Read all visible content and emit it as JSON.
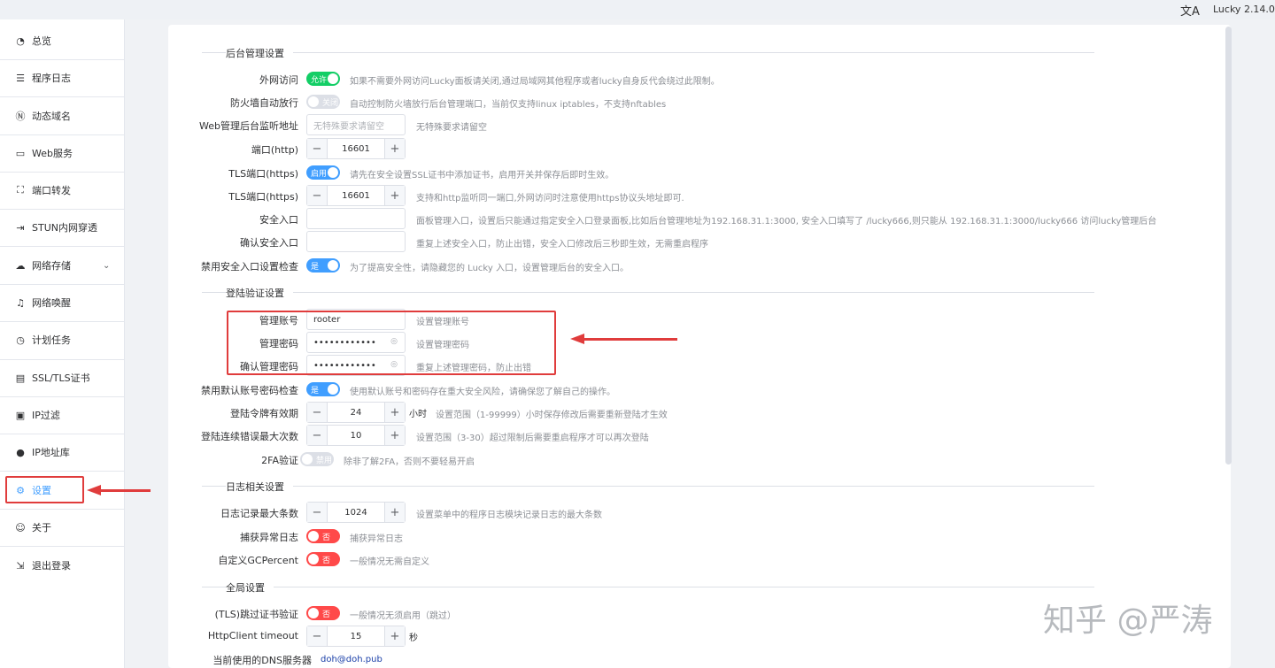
{
  "topbar": {
    "lang_icon": "文A",
    "version": "Lucky 2.14.0"
  },
  "nav": [
    {
      "label": "总览",
      "icon": "dashboard-icon",
      "glyph": "◔"
    },
    {
      "label": "程序日志",
      "icon": "log-icon",
      "glyph": "☰"
    },
    {
      "label": "动态域名",
      "icon": "ddns-icon",
      "glyph": "Ⓝ"
    },
    {
      "label": "Web服务",
      "icon": "web-icon",
      "glyph": "▭"
    },
    {
      "label": "端口转发",
      "icon": "port-forward-icon",
      "glyph": "⛶"
    },
    {
      "label": "STUN内网穿透",
      "icon": "stun-icon",
      "glyph": "⇥"
    },
    {
      "label": "网络存储",
      "icon": "cloud-icon",
      "glyph": "☁"
    },
    {
      "label": "网络唤醒",
      "icon": "bell-icon",
      "glyph": "♫"
    },
    {
      "label": "计划任务",
      "icon": "clock-icon",
      "glyph": "◷"
    },
    {
      "label": "SSL/TLS证书",
      "icon": "certificate-icon",
      "glyph": "▤"
    },
    {
      "label": "IP过滤",
      "icon": "filter-icon",
      "glyph": "▣"
    },
    {
      "label": "IP地址库",
      "icon": "user-icon",
      "glyph": "●"
    },
    {
      "label": "设置",
      "icon": "gear-icon",
      "glyph": "⚙"
    },
    {
      "label": "关于",
      "icon": "about-icon",
      "glyph": "☺"
    },
    {
      "label": "退出登录",
      "icon": "logout-icon",
      "glyph": "⇲"
    }
  ],
  "sections": {
    "admin": "后台管理设置",
    "login": "登陆验证设置",
    "log": "日志相关设置",
    "global": "全局设置"
  },
  "admin": {
    "wan_access": {
      "label": "外网访问",
      "switch": "允许",
      "hint": "如果不需要外网访问Lucky面板请关闭,通过局域网其他程序或者lucky自身反代会绕过此限制。"
    },
    "firewall": {
      "label": "防火墙自动放行",
      "switch": "关闭",
      "hint": "自动控制防火墙放行后台管理端口，当前仅支持linux iptables，不支持nftables"
    },
    "listen_addr": {
      "label": "Web管理后台监听地址",
      "placeholder": "无特殊要求请留空",
      "hint": "无特殊要求请留空"
    },
    "http_port": {
      "label": "端口(http)",
      "value": "16601"
    },
    "tls_switch": {
      "label": "TLS端口(https)",
      "switch": "启用",
      "hint": "请先在安全设置SSL证书中添加证书，启用开关并保存后即时生效。"
    },
    "tls_port": {
      "label": "TLS端口(https)",
      "value": "16601",
      "hint": "支持和http监听同一端口,外网访问时注意使用https协议头地址即可."
    },
    "safe_entry": {
      "label": "安全入口",
      "hint": "面板管理入口，设置后只能通过指定安全入口登录面板,比如后台管理地址为192.168.31.1:3000, 安全入口填写了 /lucky666,则只能从 192.168.31.1:3000/lucky666 访问lucky管理后台"
    },
    "confirm_entry": {
      "label": "确认安全入口",
      "hint": "重复上述安全入口，防止出错，安全入口修改后三秒即生效，无需重启程序"
    },
    "disable_entry_check": {
      "label": "禁用安全入口设置检查",
      "switch": "是",
      "hint": "为了提高安全性，请隐藏您的 Lucky 入口，设置管理后台的安全入口。"
    }
  },
  "login": {
    "account": {
      "label": "管理账号",
      "value": "rooter",
      "hint": "设置管理账号"
    },
    "password": {
      "label": "管理密码",
      "value": "••••••••••••",
      "hint": "设置管理密码"
    },
    "confirm_password": {
      "label": "确认管理密码",
      "value": "••••••••••••",
      "hint": "重复上述管理密码，防止出错"
    },
    "disable_default_check": {
      "label": "禁用默认账号密码检查",
      "switch": "是",
      "hint": "使用默认账号和密码存在重大安全风险，请确保您了解自己的操作。"
    },
    "token_ttl": {
      "label": "登陆令牌有效期",
      "value": "24",
      "unit": "小时",
      "hint": "设置范围（1-99999）小时保存修改后需要重新登陆才生效"
    },
    "max_errors": {
      "label": "登陆连续错误最大次数",
      "value": "10",
      "hint": "设置范围（3-30）超过限制后需要重启程序才可以再次登陆"
    },
    "twofa": {
      "label": "2FA验证",
      "switch": "禁用",
      "hint": "除非了解2FA，否则不要轻易开启"
    }
  },
  "log": {
    "max_records": {
      "label": "日志记录最大条数",
      "value": "1024",
      "hint": "设置菜单中的程序日志模块记录日志的最大条数"
    },
    "capture_errors": {
      "label": "捕获异常日志",
      "switch": "否",
      "hint": "捕获异常日志"
    },
    "gc_percent": {
      "label": "自定义GCPercent",
      "switch": "否",
      "hint": "一般情况无需自定义"
    }
  },
  "global": {
    "skip_tls": {
      "label": "(TLS)跳过证书验证",
      "switch": "否",
      "hint": "一般情况无须启用（跳过）"
    },
    "http_timeout": {
      "label": "HttpClient timeout",
      "value": "15",
      "unit": "秒"
    },
    "dns_server": {
      "label": "当前使用的DNS服务器",
      "value": "doh@doh.pub"
    }
  },
  "controls": {
    "minus": "−",
    "plus": "+",
    "eye": "◎",
    "chevron": "⌄"
  },
  "watermark": "知乎 @严涛",
  "colors": {
    "accent": "#409eff",
    "on_green": "#13ce66",
    "off_red": "#ff4949",
    "annotation_red": "#e03c3c"
  }
}
